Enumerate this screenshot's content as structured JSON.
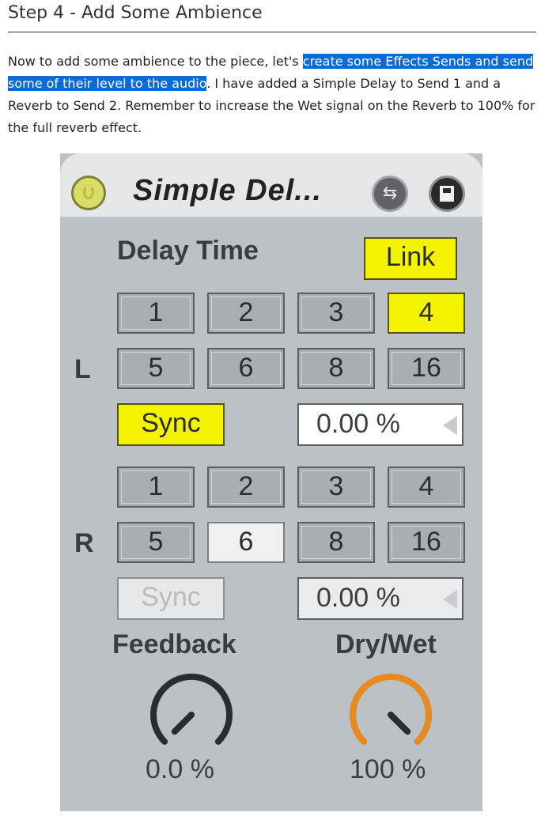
{
  "article": {
    "heading": "Step 4 - Add Some Ambience",
    "para_before": "Now to add some ambience to the piece, let's ",
    "para_highlight": "create some Effects Sends and send some of their level to the audio",
    "para_after": ". I have added a Simple Delay to Send 1 and a Reverb to Send 2. Remember to increase the Wet signal on the Reverb to 100% for the full reverb effect."
  },
  "device": {
    "title": "Simple Del...",
    "delay_time_label": "Delay Time",
    "link_label": "Link",
    "left_label": "L",
    "right_label": "R",
    "left_buttons": [
      "1",
      "2",
      "3",
      "4",
      "5",
      "6",
      "8",
      "16"
    ],
    "right_buttons": [
      "1",
      "2",
      "3",
      "4",
      "5",
      "6",
      "8",
      "16"
    ],
    "left_selected": "4",
    "right_selected": "6",
    "sync_label": "Sync",
    "left_sync_on": true,
    "right_sync_on": false,
    "left_offset": "0.00 %",
    "right_offset": "0.00 %",
    "feedback_label": "Feedback",
    "feedback_value": "0.0 %",
    "feedback_level": 0.0,
    "drywet_label": "Dry/Wet",
    "drywet_value": "100 %",
    "drywet_level": 1.0,
    "icons": {
      "power": "power-icon",
      "hot_swap": "hot-swap-icon",
      "save": "save-icon"
    },
    "colors": {
      "active": "#f3f300",
      "knob_arc_active": "#e98a1f",
      "highlight": "#0a6ad8"
    }
  }
}
